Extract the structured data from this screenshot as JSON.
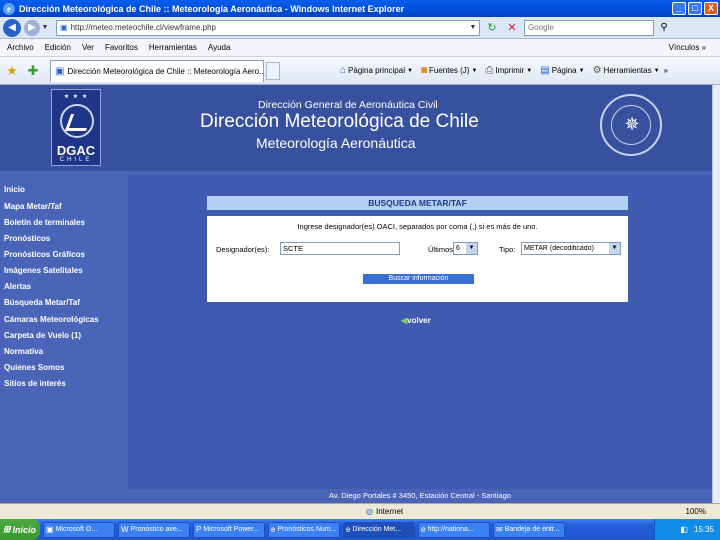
{
  "window": {
    "title": "Dirección Meteorológica de Chile :: Meteorología Aeronáutica - Windows Internet Explorer",
    "icon": "ie-icon",
    "controls": [
      "_",
      "□",
      "X"
    ]
  },
  "address_bar": {
    "url": "http://meteo.meteochile.cl/viewframe.php",
    "search_placeholder": "Google",
    "icons": [
      "back-arrow-icon",
      "forward-arrow-icon",
      "refresh-icon",
      "stop-icon",
      "search-icon"
    ]
  },
  "menu": {
    "items": [
      "Archivo",
      "Edición",
      "Ver",
      "Favoritos",
      "Herramientas",
      "Ayuda"
    ],
    "links": "Vínculos »"
  },
  "command_bar": {
    "tab_title": "Dirección Meteorológica de Chile :: Meteorología Aero...",
    "commands": [
      "Página principal",
      "Fuentes (J)",
      "Imprimir",
      "Página",
      "Herramientas"
    ]
  },
  "header": {
    "logo_text": "DGAC",
    "logo_subtext": "CHILE",
    "org_name": "Dirección General de Aeronáutica Civil",
    "main_title": "Dirección Meteorológica de Chile",
    "subtitle": "Meteorología Aeronáutica"
  },
  "sidebar": {
    "items": [
      "Inicio",
      "Mapa Metar/Taf",
      "Boletín de terminales",
      "Pronósticos",
      "Pronósticos Gráficos",
      "Imágenes Satelitales",
      "Alertas",
      "Búsqueda Metar/Taf",
      "Cámaras Meteorológicas",
      "Carpeta de Vuelo (1)",
      "Normativa",
      "Quienes Somos",
      "Sitios de interés"
    ]
  },
  "search_panel": {
    "title": "BUSQUEDA METAR/TAF",
    "instructions": "Ingrese designador(es) OACI, separados por coma (,) si es más de uno.",
    "designator_label": "Designador(es):",
    "designator_value": "SCTE",
    "last_label": "Últimos:",
    "last_value": "6",
    "type_label": "Tipo:",
    "type_value": "METAR (decodificado)",
    "submit_label": "Buscar información"
  },
  "back_link": "volver",
  "footer": "Av. Diego Portales # 3450, Estación Central - Santiago",
  "status_bar": {
    "zone": "Internet",
    "zoom": "100%"
  },
  "taskbar": {
    "start": "Inicio",
    "tasks": [
      "Microsoft O...",
      "Pronóstico ave...",
      "Microsoft Power...",
      "Pronósticos Num...",
      "Dirección Met...",
      "http://nationa...",
      "Bandeja de entr..."
    ],
    "clock": "15:35"
  }
}
